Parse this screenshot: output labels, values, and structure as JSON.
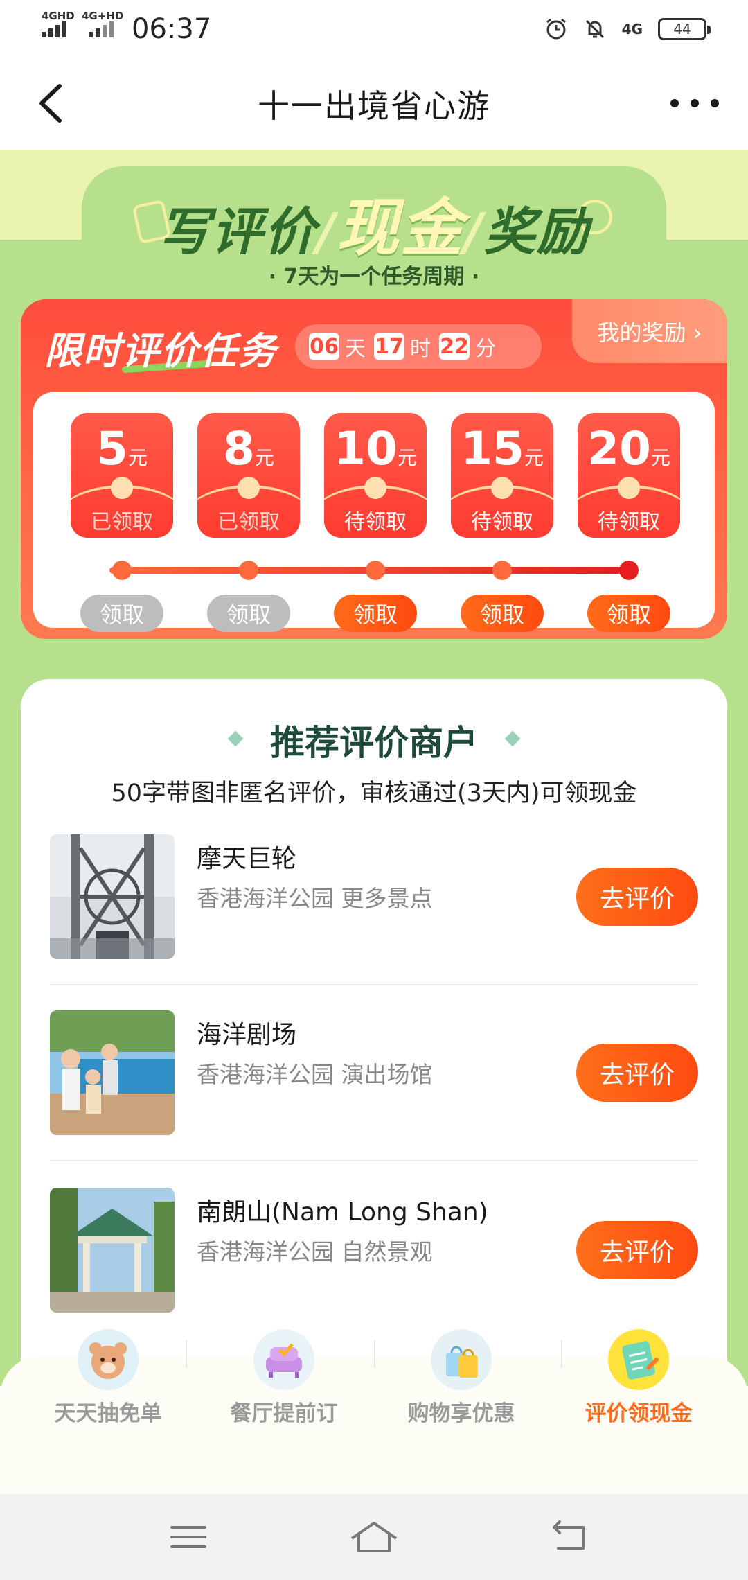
{
  "status_bar": {
    "signal1_label": "4GHD",
    "signal2_label": "4G+HD",
    "time": "06:37",
    "network_label": "4G",
    "battery": "44"
  },
  "nav": {
    "title": "十一出境省心游"
  },
  "banner": {
    "title_part1": "写评价",
    "title_part2": "现金",
    "title_part3": "奖励",
    "slash": "/",
    "subtitle": "· 7天为一个任务周期 ·"
  },
  "task": {
    "title": "限时评价任务",
    "countdown": {
      "days": "06",
      "days_unit": "天",
      "hours": "17",
      "hours_unit": "时",
      "minutes": "22",
      "minutes_unit": "分"
    },
    "my_reward_label": "我的奖励 ›",
    "currency_unit": "元",
    "coupons": [
      {
        "amount": "5",
        "status": "已领取",
        "claim_label": "领取",
        "claimed": true
      },
      {
        "amount": "8",
        "status": "已领取",
        "claim_label": "领取",
        "claimed": true
      },
      {
        "amount": "10",
        "status": "待领取",
        "claim_label": "领取",
        "claimed": false
      },
      {
        "amount": "15",
        "status": "待领取",
        "claim_label": "领取",
        "claimed": false
      },
      {
        "amount": "20",
        "status": "待领取",
        "claim_label": "领取",
        "claimed": false
      }
    ]
  },
  "recommend": {
    "title": "推荐评价商户",
    "subtitle": "50字带图非匿名评价，审核通过(3天内)可领现金",
    "merchants": [
      {
        "name": "摩天巨轮",
        "meta": "香港海洋公园 更多景点",
        "button": "去评价"
      },
      {
        "name": "海洋剧场",
        "meta": "香港海洋公园 演出场馆",
        "button": "去评价"
      },
      {
        "name": "南朗山(Nam Long Shan)",
        "meta": "香港海洋公园 自然景观",
        "button": "去评价"
      }
    ]
  },
  "tabs": [
    {
      "label": "天天抽免单",
      "icon": "bear-icon"
    },
    {
      "label": "餐厅提前订",
      "icon": "sofa-icon"
    },
    {
      "label": "购物享优惠",
      "icon": "shopping-bag-icon"
    },
    {
      "label": "评价领现金",
      "icon": "notepad-icon",
      "active": true
    }
  ],
  "colors": {
    "accent": "#ff6a1a",
    "green_bg": "#b6e08c",
    "red": "#ff4d3d"
  }
}
